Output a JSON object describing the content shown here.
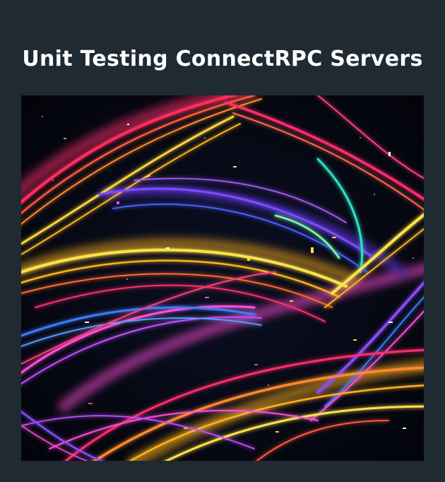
{
  "article": {
    "title": "Unit Testing ConnectRPC Servers",
    "cover_image": {
      "description": "abstract neon light streaks artwork",
      "palette": [
        "#ff2d6b",
        "#ffb21f",
        "#ffe14a",
        "#8a4dff",
        "#3a7bff",
        "#2fe0c4",
        "#ff4fd8"
      ]
    }
  },
  "theme": {
    "background": "#1f2a33",
    "title_color": "#ffffff"
  }
}
